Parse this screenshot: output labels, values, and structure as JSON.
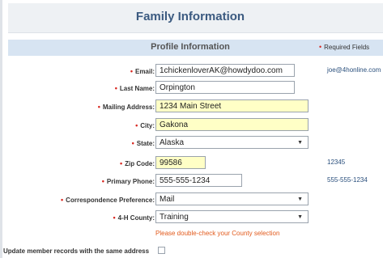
{
  "page": {
    "title": "Family Information",
    "section_title": "Profile Information",
    "required_fields_label": "Required Fields",
    "required_marker": "•"
  },
  "form": {
    "email": {
      "label": "Email:",
      "value": "1chickenloverAK@howdydoo.com",
      "previous": "joe@4honline.com"
    },
    "last_name": {
      "label": "Last Name:",
      "value": "Orpington"
    },
    "mailing_address": {
      "label": "Mailing Address:",
      "value": "1234 Main Street"
    },
    "city": {
      "label": "City:",
      "value": "Gakona"
    },
    "state": {
      "label": "State:",
      "value": "Alaska"
    },
    "zip_code": {
      "label": "Zip Code:",
      "value": "99586",
      "previous": "12345"
    },
    "primary_phone": {
      "label": "Primary Phone:",
      "value": "555-555-1234",
      "previous": "555-555-1234"
    },
    "correspondence_preference": {
      "label": "Correspondence Preference:",
      "value": "Mail"
    },
    "county": {
      "label": "4-H County:",
      "value": "Training"
    },
    "county_warning": "Please double-check your County selection",
    "update_member_records_label": "Update member records with the same address",
    "update_member_records_checked": false
  },
  "colors": {
    "required_dot": "#d8261f",
    "highlight_field": "#ffffc6",
    "section_bar": "#d7e4f2",
    "title_text": "#3b5a80",
    "warning_text": "#e25a1c"
  },
  "icons": {
    "dropdown_caret": "▼"
  }
}
